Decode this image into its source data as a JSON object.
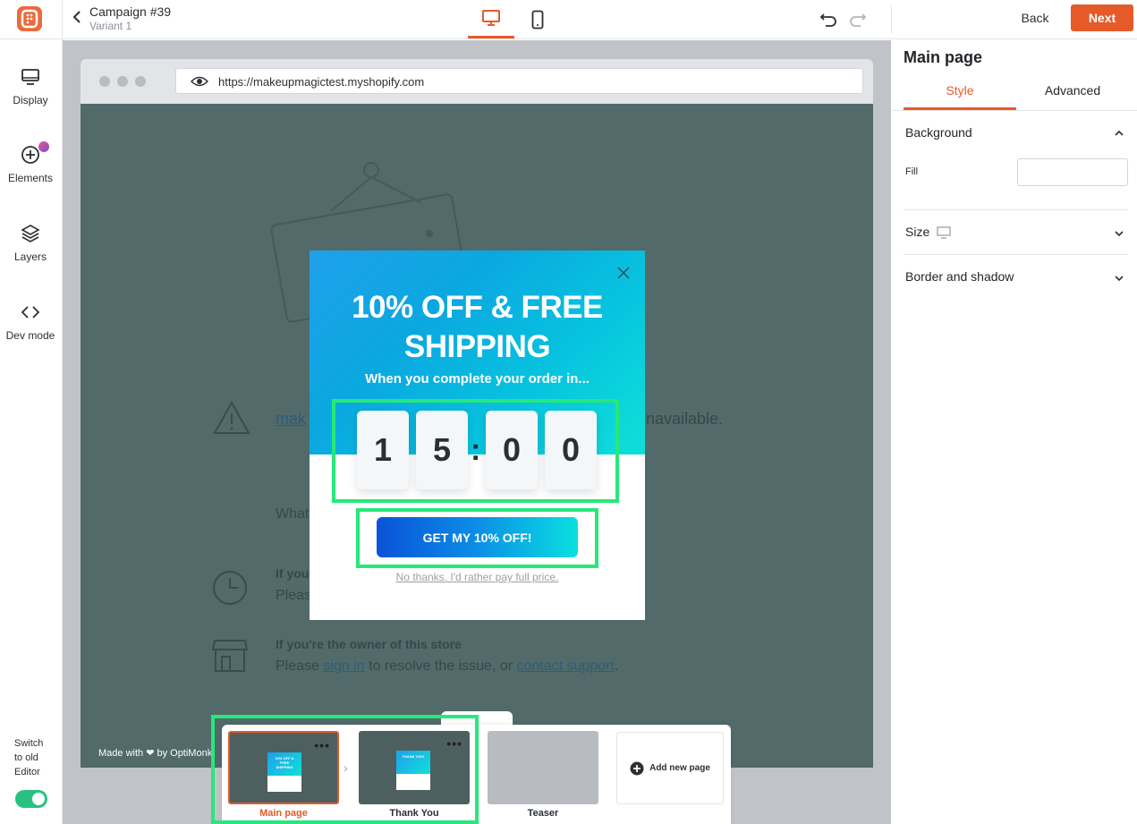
{
  "header": {
    "campaign_title": "Campaign #39",
    "variant": "Variant 1",
    "back_label": "Back",
    "next_label": "Next"
  },
  "sidebar": {
    "items": [
      {
        "label": "Display",
        "icon": "monitor-icon"
      },
      {
        "label": "Elements",
        "icon": "plus-circle-icon"
      },
      {
        "label": "Layers",
        "icon": "layers-icon"
      },
      {
        "label": "Dev mode",
        "icon": "code-icon"
      }
    ],
    "switch_label": "Switch to old Editor",
    "switch_on": true
  },
  "browser": {
    "url": "https://makeupmagictest.myshopify.com"
  },
  "background_page": {
    "unavailable_link": "mak",
    "unavailable_tail": "navailable.",
    "what_text": "What",
    "owner_heading_short": "If you",
    "please_short": "Pleas",
    "owner_heading": "If you're the owner of this store",
    "please": "Please",
    "sign_in": "sign in",
    "resolve": "to resolve the issue, or",
    "contact_support": "contact support",
    "period": ".",
    "made_with": "Made with ❤ by OptiMonk"
  },
  "popup": {
    "title": "10% OFF & FREE SHIPPING",
    "subtitle": "When you complete your order in...",
    "digits": [
      "1",
      "5",
      "0",
      "0"
    ],
    "colon": ":",
    "cta": "GET MY 10% OFF!",
    "decline": "No thanks. I'd rather pay full price."
  },
  "pages": {
    "items": [
      {
        "label": "Main page",
        "thumb_text": "10% OFF & FREE SHIPPING",
        "menu": "•••"
      },
      {
        "label": "Thank You",
        "thumb_text": "THANK YOU!",
        "menu": "•••"
      },
      {
        "label": "Teaser"
      }
    ],
    "add_label": "Add new page"
  },
  "right_panel": {
    "title": "Main page",
    "tabs": [
      "Style",
      "Advanced"
    ],
    "sections": {
      "background": "Background",
      "fill_label": "Fill",
      "size": "Size",
      "border_shadow": "Border and shadow"
    }
  },
  "colors": {
    "accent": "#e65a2a",
    "highlight": "#27e87a",
    "popup_gradient_start": "#1fa0ea",
    "popup_gradient_end": "#10e0d8"
  }
}
